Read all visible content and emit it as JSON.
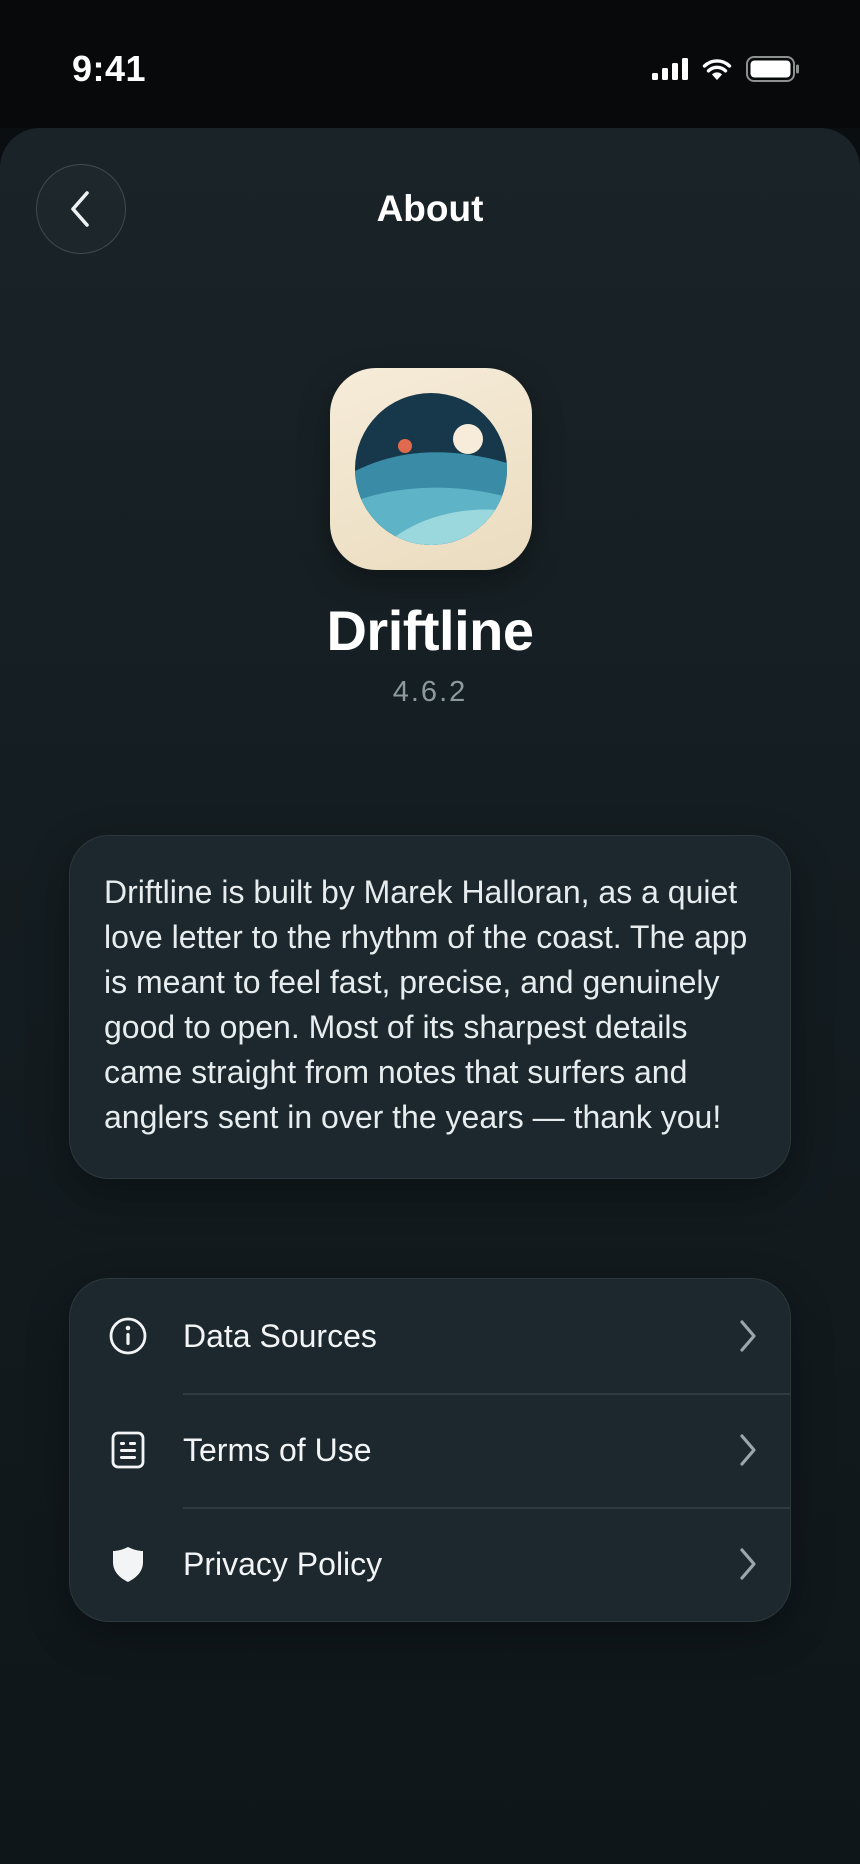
{
  "status_bar": {
    "time": "9:41"
  },
  "header": {
    "title": "About",
    "back_icon": "chevron-left-icon"
  },
  "app": {
    "name": "Driftline",
    "version": "4.6.2",
    "icon": "seascape-moon-icon"
  },
  "about": {
    "text": "Driftline is built by Marek Halloran, as a quiet love letter to the rhythm of the coast. The app is meant to feel fast, precise, and genuinely good to open. Most of its sharpest details came straight from notes that surfers and anglers sent in over the years — thank you!"
  },
  "links": [
    {
      "label": "Data Sources",
      "icon": "info-circle-icon"
    },
    {
      "label": "Terms of Use",
      "icon": "document-icon"
    },
    {
      "label": "Privacy Policy",
      "icon": "shield-icon"
    }
  ],
  "colors": {
    "background": "#0a0e10",
    "card": "#1c282d",
    "text_primary": "#f2f4f5",
    "text_secondary": "#8c9a9f",
    "icon_bg": "#f6ecd9",
    "ocean_dark": "#17384a",
    "ocean_mid": "#3a8ba6",
    "ocean_light": "#9ad8de",
    "moon": "#f6ecd9",
    "accent_dot": "#e06a4d"
  }
}
